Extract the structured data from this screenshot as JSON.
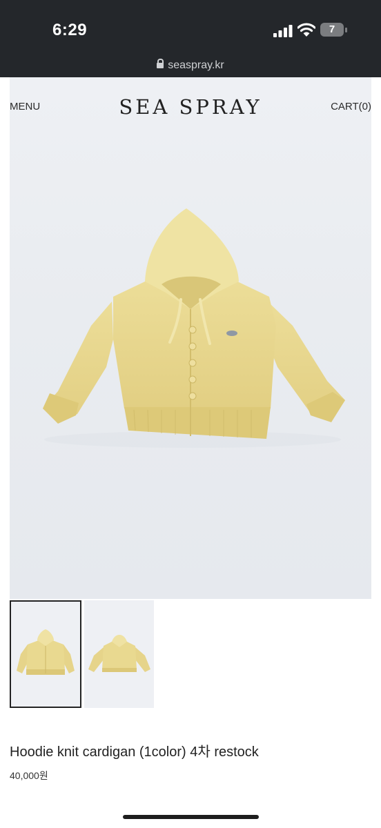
{
  "status_bar": {
    "time": "6:29",
    "battery": "7",
    "url": "seaspray.kr"
  },
  "header": {
    "menu_label": "MENU",
    "brand": "SEA SPRAY",
    "cart_label": "CART(0)"
  },
  "product": {
    "name": "Hoodie knit cardigan (1color) 4차 restock",
    "price": "40,000원",
    "thumbnail_count": 2,
    "selected_thumbnail": 1
  },
  "colors": {
    "status_bar_bg": "#24272b",
    "knit_yellow": "#e7d68e",
    "photo_bg": "#eceef2"
  }
}
